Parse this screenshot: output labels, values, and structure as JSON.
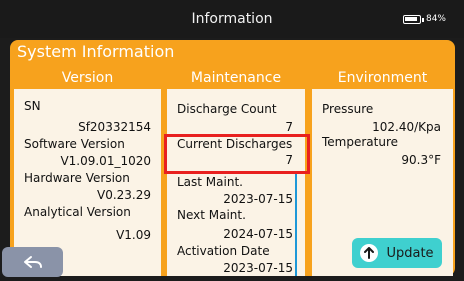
{
  "topbar": {
    "title": "Information",
    "battery": "84%"
  },
  "system_title": "System Information",
  "version": {
    "header": "Version",
    "sn_label": "SN",
    "sn_value": "Sf20332154",
    "software_label": "Software Version",
    "software_value": "V1.09.01_1020",
    "hardware_label": "Hardware Version",
    "hardware_value": "V0.23.29",
    "analytical_label": "Analytical Version",
    "analytical_value": "V1.09"
  },
  "maintenance": {
    "header": "Maintenance",
    "discharge_count_label": "Discharge Count",
    "discharge_count_value": "7",
    "current_discharges_label": "Current Discharges",
    "current_discharges_value": "7",
    "last_maint_label": "Last Maint.",
    "last_maint_value": "2023-07-15",
    "next_maint_label": "Next Maint.",
    "next_maint_value": "2024-07-15",
    "activation_label": "Activation Date",
    "activation_value": "2023-07-15"
  },
  "environment": {
    "header": "Environment",
    "pressure_label": "Pressure",
    "pressure_value": "102.40/Kpa",
    "temperature_label": "Temperature",
    "temperature_value": "90.3°F"
  },
  "buttons": {
    "update": "Update"
  }
}
